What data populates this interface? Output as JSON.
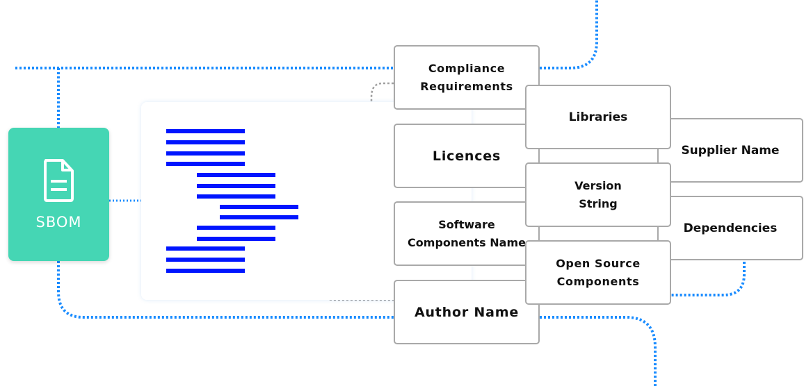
{
  "sbom": {
    "label": "SBOM",
    "icon": "document-icon",
    "color": "#45d6b4"
  },
  "colors": {
    "connector_blue": "#1a8cff",
    "bar_blue": "#0015ff",
    "link_gray": "#a0a0a0",
    "box_border": "#a9a9a9"
  },
  "boxes": {
    "compliance": "Compliance\nRequirements",
    "licences": "Licences",
    "software": "Software\nComponents Name",
    "author": "Author Name",
    "libraries": "Libraries",
    "version": "Version\nString",
    "open_source": "Open Source\nComponents",
    "supplier": "Supplier Name",
    "dependencies": "Dependencies"
  }
}
